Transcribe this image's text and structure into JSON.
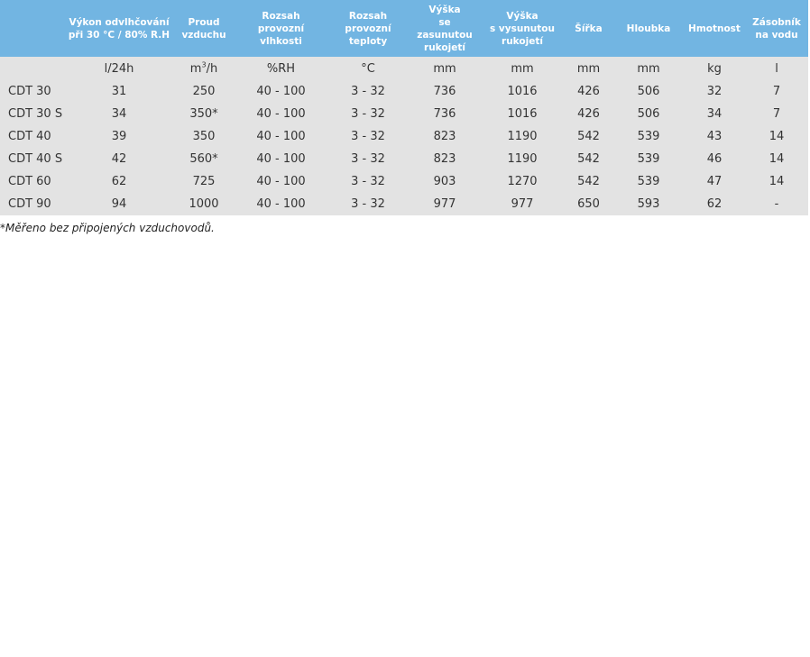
{
  "colors": {
    "header_bg": "#72b5e2",
    "body_bg": "#e3e3e3",
    "header_text": "#ffffff"
  },
  "headers": [
    "",
    "Výkon odvlhčování\npři 30 °C / 80% R.H",
    "Proud\nvzduchu",
    "Rozsah\nprovozní\nvlhkosti",
    "Rozsah\nprovozní\nteploty",
    "Výška\nse zasunutou\nrukojetí",
    "Výška\ns vysunutou\nrukojetí",
    "Šířka",
    "Hloubka",
    "Hmotnost",
    "Zásobník\nna vodu"
  ],
  "units": {
    "capacity": "l/24h",
    "airflow_base": "m",
    "airflow_exp": "3",
    "airflow_rest": "/h",
    "humidity": "%RH",
    "temperature": "°C",
    "height_retracted": "mm",
    "height_extended": "mm",
    "width": "mm",
    "depth": "mm",
    "weight": "kg",
    "tank": "l"
  },
  "rows": [
    [
      "CDT 30",
      "31",
      "250",
      "40 - 100",
      "3 - 32",
      "736",
      "1016",
      "426",
      "506",
      "32",
      "7"
    ],
    [
      "CDT 30 S",
      "34",
      "350*",
      "40 - 100",
      "3 - 32",
      "736",
      "1016",
      "426",
      "506",
      "34",
      "7"
    ],
    [
      "CDT 40",
      "39",
      "350",
      "40 - 100",
      "3 - 32",
      "823",
      "1190",
      "542",
      "539",
      "43",
      "14"
    ],
    [
      "CDT 40 S",
      "42",
      "560*",
      "40 - 100",
      "3 - 32",
      "823",
      "1190",
      "542",
      "539",
      "46",
      "14"
    ],
    [
      "CDT 60",
      "62",
      "725",
      "40 - 100",
      "3 - 32",
      "903",
      "1270",
      "542",
      "539",
      "47",
      "14"
    ],
    [
      "CDT 90",
      "94",
      "1000",
      "40 - 100",
      "3 - 32",
      "977",
      "977",
      "650",
      "593",
      "62",
      "-"
    ]
  ],
  "footnote": "*Měřeno bez připojených vzduchovodů."
}
